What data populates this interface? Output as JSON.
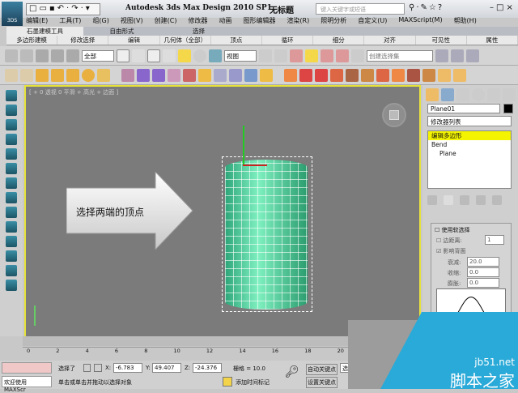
{
  "title": {
    "app": "Autodesk 3ds Max Design 2010 SP1",
    "document": "无标题",
    "search_placeholder": "键入关键字或短语",
    "logo": "3DS"
  },
  "menu": [
    "编辑(E)",
    "工具(T)",
    "组(G)",
    "视图(V)",
    "创建(C)",
    "修改器",
    "动画",
    "图形编辑器",
    "渲染(R)",
    "照明分析",
    "自定义(U)",
    "MAXScript(M)",
    "帮助(H)"
  ],
  "ribbon": {
    "tabs": [
      "石墨建模工具",
      "自由形式",
      "选择"
    ],
    "panels": [
      "多边形建模",
      "修改选择",
      "编辑",
      "几何体（全部）",
      "顶点",
      "循环",
      "细分",
      "对齐",
      "可见性",
      "属性"
    ]
  },
  "toolbar": {
    "filter": "全部",
    "coord": "视图",
    "selection_set": "创建选择集"
  },
  "viewport": {
    "label": "[ + 0 透视 0 平滑 + 高光 + 边面 ]",
    "callout": "选择两端的顶点"
  },
  "command_panel": {
    "object_name": "Plane01",
    "modifier_list": "修改器列表",
    "stack": [
      "编辑多边形",
      "Bend",
      "Plane"
    ],
    "soft_selection": {
      "use_label": "使用软选择",
      "edge_distance_label": "边距离:",
      "edge_distance_value": "1",
      "affect_backfacing_label": "影响背面",
      "falloff_label": "衰减:",
      "falloff_value": "20.0",
      "pinch_label": "收缩:",
      "pinch_value": "0.0",
      "bubble_label": "膨胀:",
      "bubble_value": "0.0"
    }
  },
  "timeline": {
    "ticks": [
      "0",
      "2",
      "4",
      "6",
      "8",
      "10",
      "12",
      "14",
      "16",
      "18",
      "20"
    ]
  },
  "status": {
    "selection": "选择了",
    "x_label": "X:",
    "x": "-6.783",
    "y_label": "Y:",
    "y": "49.407",
    "z_label": "Z:",
    "z": "-24.376",
    "grid": "栅格 = 10.0",
    "welcome": "欢迎使用 MAXScr",
    "prompt": "单击或单击并拖动以选择对象",
    "add_time_tag": "添加时间标记",
    "auto_key": "自动关键点",
    "set_key": "设置关键点",
    "sel_short": "选定"
  },
  "watermark": {
    "url": "jb51.net",
    "name": "脚本之家"
  }
}
